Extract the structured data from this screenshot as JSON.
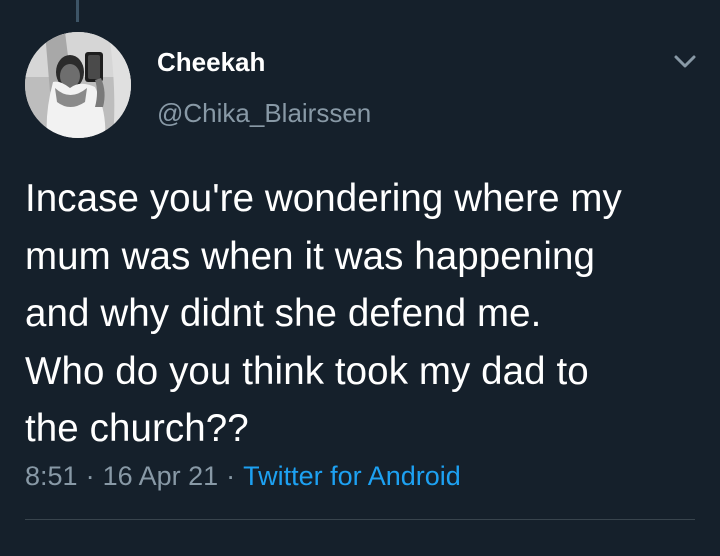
{
  "tweet": {
    "author": {
      "display_name": "Cheekah",
      "handle": "@Chika_Blairssen"
    },
    "text_lines": [
      "Incase you're wondering where my",
      "mum was when it was happening",
      "and why didnt she defend me.",
      "Who do you think took my dad to",
      "the church??"
    ],
    "time": "8:51",
    "date": "16 Apr 21",
    "source": "Twitter for Android",
    "separator": "·"
  },
  "icons": {
    "more": "chevron-down-icon"
  },
  "colors": {
    "background": "#15202b",
    "text_primary": "#ffffff",
    "text_secondary": "#8899a6",
    "link": "#1da1f2",
    "divider": "#38444d"
  }
}
